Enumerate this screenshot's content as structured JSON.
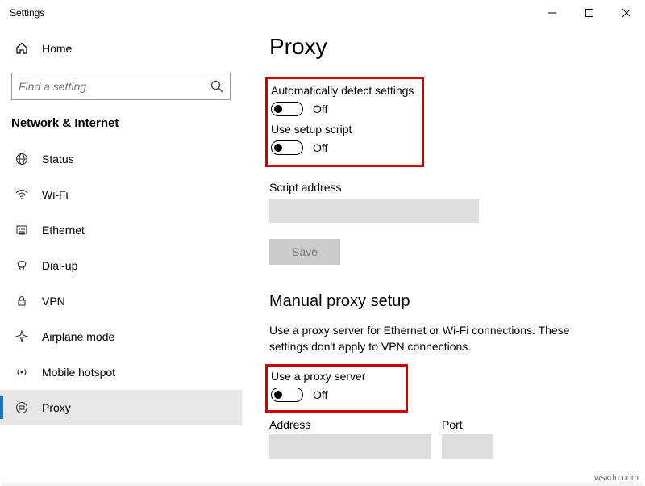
{
  "window": {
    "title": "Settings"
  },
  "sidebar": {
    "home_label": "Home",
    "search_placeholder": "Find a setting",
    "section_header": "Network & Internet",
    "items": [
      {
        "label": "Status"
      },
      {
        "label": "Wi-Fi"
      },
      {
        "label": "Ethernet"
      },
      {
        "label": "Dial-up"
      },
      {
        "label": "VPN"
      },
      {
        "label": "Airplane mode"
      },
      {
        "label": "Mobile hotspot"
      },
      {
        "label": "Proxy"
      }
    ]
  },
  "content": {
    "page_title": "Proxy",
    "auto_detect": {
      "label": "Automatically detect settings",
      "state": "Off"
    },
    "setup_script": {
      "label": "Use setup script",
      "state": "Off"
    },
    "script_address_label": "Script address",
    "save_label": "Save",
    "manual_heading": "Manual proxy setup",
    "manual_desc": "Use a proxy server for Ethernet or Wi-Fi connections. These settings don't apply to VPN connections.",
    "use_proxy": {
      "label": "Use a proxy server",
      "state": "Off"
    },
    "address_label": "Address",
    "port_label": "Port"
  },
  "watermark": "wsxdn.com"
}
